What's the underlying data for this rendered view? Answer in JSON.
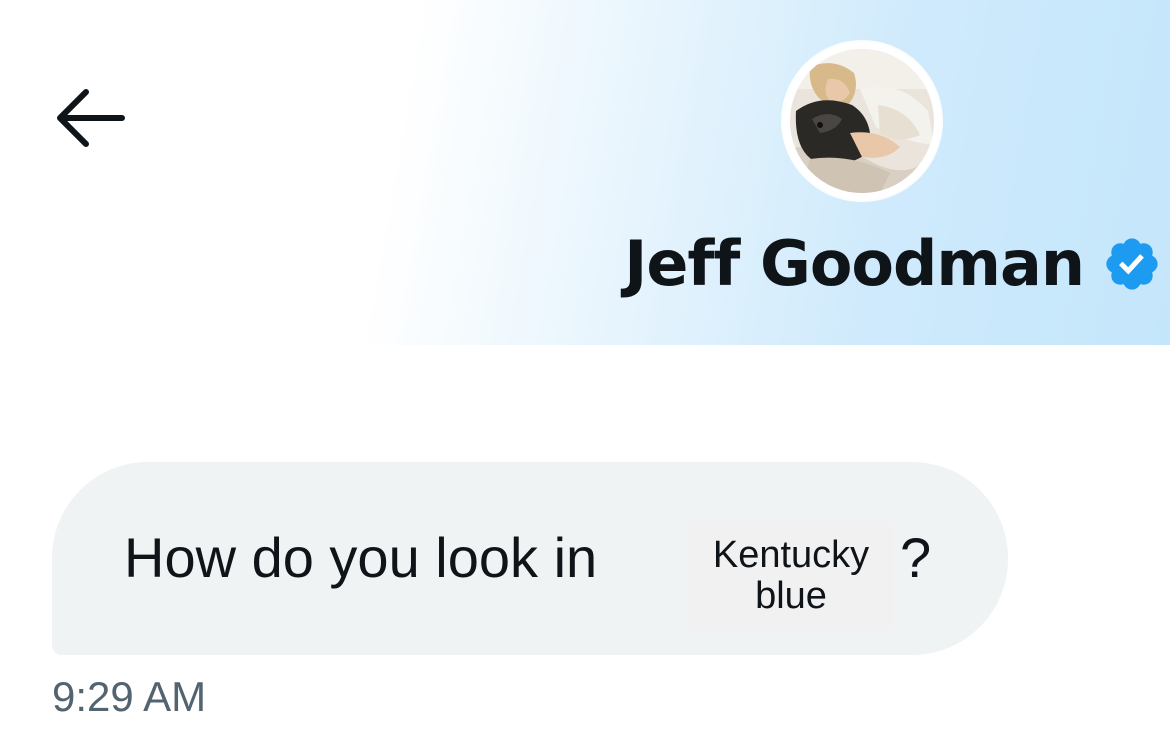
{
  "header": {
    "back_icon": "arrow-left-icon",
    "profile_name": "Jeff Goodman",
    "verified_icon": "verified-badge-icon",
    "verified_color": "#1d9bf0",
    "background_accent": "#c4e6fb"
  },
  "message": {
    "text_before": "How do you look in",
    "overlay_line_1": "Kentucky",
    "overlay_line_2": "blue",
    "text_after": "?",
    "timestamp": "9:29 AM",
    "bubble_color": "#eff3f4"
  }
}
